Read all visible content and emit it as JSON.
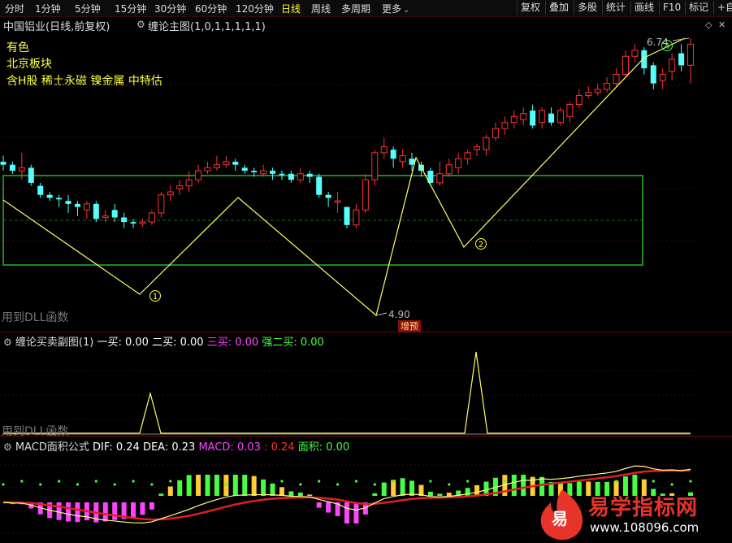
{
  "toolbar": {
    "timeframes": [
      "分时",
      "1分钟",
      "5分钟",
      "15分钟",
      "30分钟",
      "60分钟",
      "120分钟",
      "日线",
      "周线",
      "多周期",
      "更多"
    ],
    "active_timeframe": "日线",
    "right_buttons": [
      "复权",
      "叠加",
      "多股",
      "统计",
      "画线",
      "F10",
      "标记",
      "+自"
    ]
  },
  "main": {
    "stock": "中国铝业(日线,前复权)",
    "indicator": "缠论主图(1,0,1,1,1,1,1)",
    "annotations": [
      "有色",
      "北京板块",
      "含H股 稀土永磁 镍金属 中特估"
    ],
    "high_label": "6.74",
    "low_label": "4.90",
    "badge": "增预",
    "dll_note": "用到DLL函数",
    "markers": [
      "1",
      "2",
      "4"
    ]
  },
  "sub1": {
    "title": "缠论买卖副图(1)",
    "items": [
      {
        "label": "一买:",
        "value": "0.00",
        "color": "#ffffff"
      },
      {
        "label": "二买:",
        "value": "0.00",
        "color": "#ffffff"
      },
      {
        "label": "三买:",
        "value": "0.00",
        "color": "#ff44ff"
      },
      {
        "label": "强二买:",
        "value": "0.00",
        "color": "#44ff44"
      }
    ],
    "dll_note": "用到DLL函数"
  },
  "sub2": {
    "title": "MACD面积公式",
    "items": [
      {
        "label": "DIF:",
        "value": "0.24",
        "color": "#ffffff"
      },
      {
        "label": "DEA:",
        "value": "0.23",
        "color": "#ffff44"
      },
      {
        "label": "MACD:",
        "value": "0.03",
        "color": "#ff44ff"
      },
      {
        "label": ":",
        "value": "0.24",
        "color": "#ff3333"
      },
      {
        "label": "面积:",
        "value": "0.00",
        "color": "#44ff44"
      }
    ]
  },
  "watermark": {
    "glyph": "易",
    "name": "易学指标网",
    "url": "www.108096.com"
  },
  "colors": {
    "up": "#ff3232",
    "down": "#54ffff",
    "bi_line": "#ffff66",
    "box": "#1a8a1a"
  },
  "candles": [
    [
      5.92,
      5.9,
      5.96,
      5.86
    ],
    [
      5.9,
      5.86,
      5.92,
      5.84
    ],
    [
      5.86,
      5.88,
      5.98,
      5.8
    ],
    [
      5.88,
      5.78,
      5.9,
      5.76
    ],
    [
      5.76,
      5.7,
      5.78,
      5.68
    ],
    [
      5.7,
      5.68,
      5.72,
      5.66
    ],
    [
      5.68,
      5.67,
      5.7,
      5.62
    ],
    [
      5.66,
      5.64,
      5.7,
      5.58
    ],
    [
      5.64,
      5.62,
      5.66,
      5.56
    ],
    [
      5.6,
      5.64,
      5.66,
      5.54
    ],
    [
      5.64,
      5.54,
      5.66,
      5.52
    ],
    [
      5.55,
      5.56,
      5.6,
      5.52
    ],
    [
      5.6,
      5.55,
      5.64,
      5.52
    ],
    [
      5.55,
      5.52,
      5.58,
      5.48
    ],
    [
      5.52,
      5.51,
      5.54,
      5.48
    ],
    [
      5.51,
      5.52,
      5.54,
      5.49
    ],
    [
      5.52,
      5.58,
      5.6,
      5.5
    ],
    [
      5.58,
      5.7,
      5.72,
      5.55
    ],
    [
      5.7,
      5.72,
      5.76,
      5.66
    ],
    [
      5.74,
      5.76,
      5.8,
      5.7
    ],
    [
      5.76,
      5.8,
      5.86,
      5.72
    ],
    [
      5.8,
      5.86,
      5.9,
      5.78
    ],
    [
      5.86,
      5.88,
      5.92,
      5.84
    ],
    [
      5.88,
      5.9,
      5.96,
      5.86
    ],
    [
      5.9,
      5.92,
      5.96,
      5.88
    ],
    [
      5.92,
      5.9,
      5.94,
      5.86
    ],
    [
      5.88,
      5.86,
      5.9,
      5.84
    ],
    [
      5.86,
      5.85,
      5.88,
      5.82
    ],
    [
      5.84,
      5.86,
      5.9,
      5.82
    ],
    [
      5.86,
      5.84,
      5.88,
      5.8
    ],
    [
      5.84,
      5.83,
      5.86,
      5.8
    ],
    [
      5.84,
      5.8,
      5.86,
      5.78
    ],
    [
      5.8,
      5.84,
      5.88,
      5.78
    ],
    [
      5.84,
      5.82,
      5.86,
      5.78
    ],
    [
      5.82,
      5.7,
      5.84,
      5.68
    ],
    [
      5.7,
      5.68,
      5.72,
      5.62
    ],
    [
      5.66,
      5.66,
      5.72,
      5.58
    ],
    [
      5.62,
      5.5,
      5.62,
      5.48
    ],
    [
      5.5,
      5.6,
      5.64,
      5.48
    ],
    [
      5.6,
      5.8,
      5.84,
      5.58
    ],
    [
      5.8,
      5.98,
      6.0,
      5.76
    ],
    [
      5.98,
      6.02,
      6.08,
      5.94
    ],
    [
      6.0,
      5.94,
      6.02,
      5.88
    ],
    [
      5.92,
      5.96,
      6.0,
      5.88
    ],
    [
      5.94,
      5.9,
      5.98,
      5.86
    ],
    [
      5.9,
      5.86,
      5.92,
      5.82
    ],
    [
      5.86,
      5.78,
      5.88,
      5.76
    ],
    [
      5.78,
      5.84,
      5.92,
      5.76
    ],
    [
      5.84,
      5.9,
      5.94,
      5.82
    ],
    [
      5.88,
      5.94,
      5.98,
      5.84
    ],
    [
      5.94,
      5.98,
      6.0,
      5.9
    ],
    [
      6.0,
      6.02,
      6.04,
      5.96
    ],
    [
      6.0,
      6.08,
      6.1,
      5.96
    ],
    [
      6.08,
      6.14,
      6.18,
      6.06
    ],
    [
      6.14,
      6.18,
      6.22,
      6.1
    ],
    [
      6.18,
      6.22,
      6.26,
      6.14
    ],
    [
      6.2,
      6.24,
      6.28,
      6.16
    ],
    [
      6.26,
      6.16,
      6.3,
      6.14
    ],
    [
      6.18,
      6.26,
      6.28,
      6.14
    ],
    [
      6.24,
      6.18,
      6.28,
      6.16
    ],
    [
      6.18,
      6.26,
      6.28,
      6.16
    ],
    [
      6.22,
      6.3,
      6.32,
      6.18
    ],
    [
      6.3,
      6.36,
      6.4,
      6.28
    ],
    [
      6.36,
      6.38,
      6.42,
      6.34
    ],
    [
      6.38,
      6.4,
      6.44,
      6.36
    ],
    [
      6.4,
      6.44,
      6.48,
      6.38
    ],
    [
      6.44,
      6.5,
      6.54,
      6.42
    ],
    [
      6.5,
      6.62,
      6.66,
      6.48
    ],
    [
      6.62,
      6.66,
      6.7,
      6.58
    ],
    [
      6.66,
      6.54,
      6.68,
      6.5
    ],
    [
      6.56,
      6.44,
      6.58,
      6.4
    ],
    [
      6.46,
      6.5,
      6.54,
      6.4
    ],
    [
      6.52,
      6.6,
      6.64,
      6.46
    ],
    [
      6.64,
      6.56,
      6.7,
      6.52
    ],
    [
      6.56,
      6.7,
      6.74,
      6.44
    ]
  ]
}
